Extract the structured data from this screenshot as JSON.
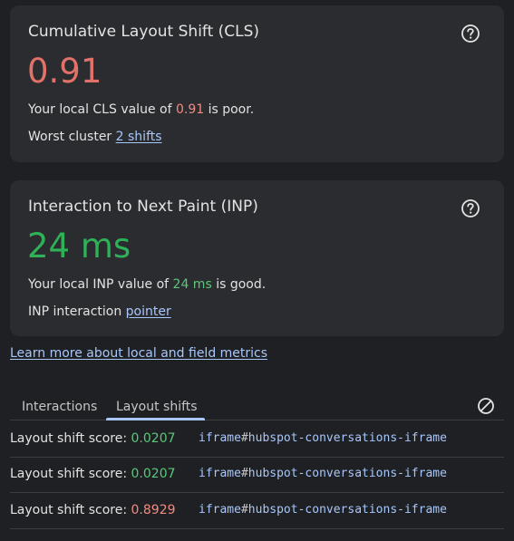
{
  "cls": {
    "title": "Cumulative Layout Shift (CLS)",
    "value": "0.91",
    "desc_prefix": "Your local CLS value of ",
    "desc_value": "0.91",
    "desc_suffix": " is poor.",
    "extra_label": "Worst cluster",
    "extra_link": "2 shifts",
    "status_color": "#e2716a"
  },
  "inp": {
    "title": "Interaction to Next Paint (INP)",
    "value": "24 ms",
    "desc_prefix": "Your local INP value of ",
    "desc_value": "24 ms",
    "desc_suffix": " is good.",
    "extra_label": "INP interaction",
    "extra_link": "pointer",
    "status_color": "#2fb157"
  },
  "learn_more": "Learn more about local and field metrics",
  "tabs": [
    {
      "label": "Interactions",
      "active": false
    },
    {
      "label": "Layout shifts",
      "active": true
    }
  ],
  "icons": {
    "help": "help-circle-icon",
    "clear": "clear-block-icon"
  },
  "layout_shifts": [
    {
      "label": "Layout shift score: ",
      "score": "0.0207",
      "rating": "good",
      "node_tag": "iframe",
      "node_hash": "#",
      "node_id": "hubspot-conversations-iframe"
    },
    {
      "label": "Layout shift score: ",
      "score": "0.0207",
      "rating": "good",
      "node_tag": "iframe",
      "node_hash": "#",
      "node_id": "hubspot-conversations-iframe"
    },
    {
      "label": "Layout shift score: ",
      "score": "0.8929",
      "rating": "poor",
      "node_tag": "iframe",
      "node_hash": "#",
      "node_id": "hubspot-conversations-iframe"
    }
  ],
  "colors": {
    "background": "#1f2023",
    "card": "#2b2c2f",
    "poor": "#e2716a",
    "good": "#2fb157",
    "link": "#a8c7fa"
  }
}
